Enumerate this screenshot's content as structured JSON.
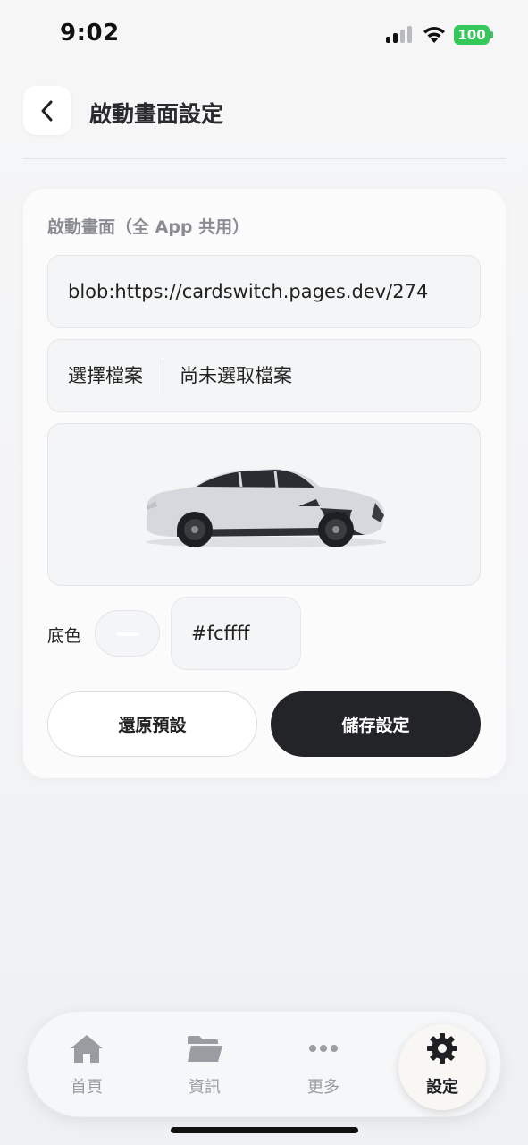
{
  "status_bar": {
    "time": "9:02",
    "battery": "100",
    "battery_color": "#34c759"
  },
  "header": {
    "back_icon": "chevron-left-icon",
    "title": "啟動畫面設定"
  },
  "splash_settings": {
    "section_label": "啟動畫面（全 App 共用）",
    "image_url": "blob:https://cardswitch.pages.dev/274",
    "file_picker": {
      "button_label": "選擇檔案",
      "status": "尚未選取檔案"
    },
    "preview_image": "car-image",
    "background": {
      "label": "底色",
      "color_value": "#fcffff"
    },
    "reset_label": "還原預設",
    "save_label": "儲存設定"
  },
  "bottom_nav": {
    "items": [
      {
        "label": "首頁",
        "icon": "home-icon"
      },
      {
        "label": "資訊",
        "icon": "folder-icon"
      },
      {
        "label": "更多",
        "icon": "more-icon"
      },
      {
        "label": "設定",
        "icon": "gear-icon",
        "active": true
      }
    ]
  },
  "colors": {
    "primary_button": "#232428",
    "background": "#f3f4f6"
  }
}
